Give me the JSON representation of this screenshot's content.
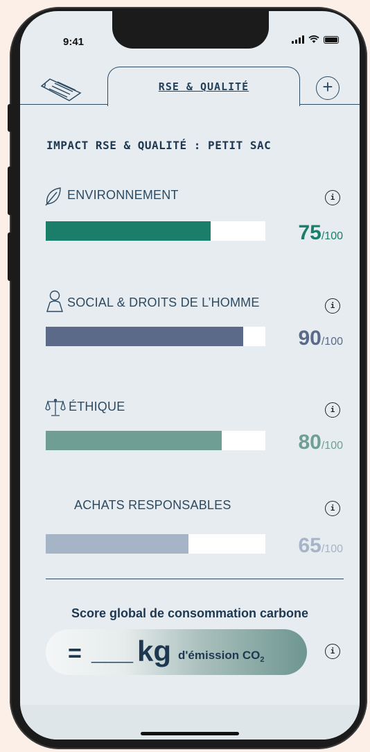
{
  "status": {
    "time": "9:41"
  },
  "tab": {
    "title": "RSE & QUALITÉ"
  },
  "heading": "IMPACT RSE & QUALITÉ : PETIT SAC",
  "info_glyph": "i",
  "plus_glyph": "+",
  "categories": [
    {
      "label": "ENVIRONNEMENT",
      "icon": "leaf-icon",
      "value": 75,
      "max": "/100",
      "fill_color": "#1a7e6b",
      "score_color": "#1a7e6b"
    },
    {
      "label": "SOCIAL & DROITS DE L’HOMME",
      "icon": "person-icon",
      "value": 90,
      "max": "/100",
      "fill_color": "#5b6a88",
      "score_color": "#5b6a88"
    },
    {
      "label": "ÉTHIQUE",
      "icon": "scales-icon",
      "value": 80,
      "max": "/100",
      "fill_color": "#6f9f94",
      "score_color": "#6f9f94"
    },
    {
      "label": "ACHATS RESPONSABLES",
      "icon": "",
      "value": 65,
      "max": "/100",
      "fill_color": "#a6b4c8",
      "score_color": "#a6b4c8"
    }
  ],
  "carbon": {
    "title": "Score global de consommation carbone",
    "equals": "=",
    "blank": "___",
    "unit": "kg",
    "text": "d'émission CO",
    "sub": "2"
  },
  "colors": {
    "accent": "#1f3852",
    "background": "#e6ecef"
  }
}
